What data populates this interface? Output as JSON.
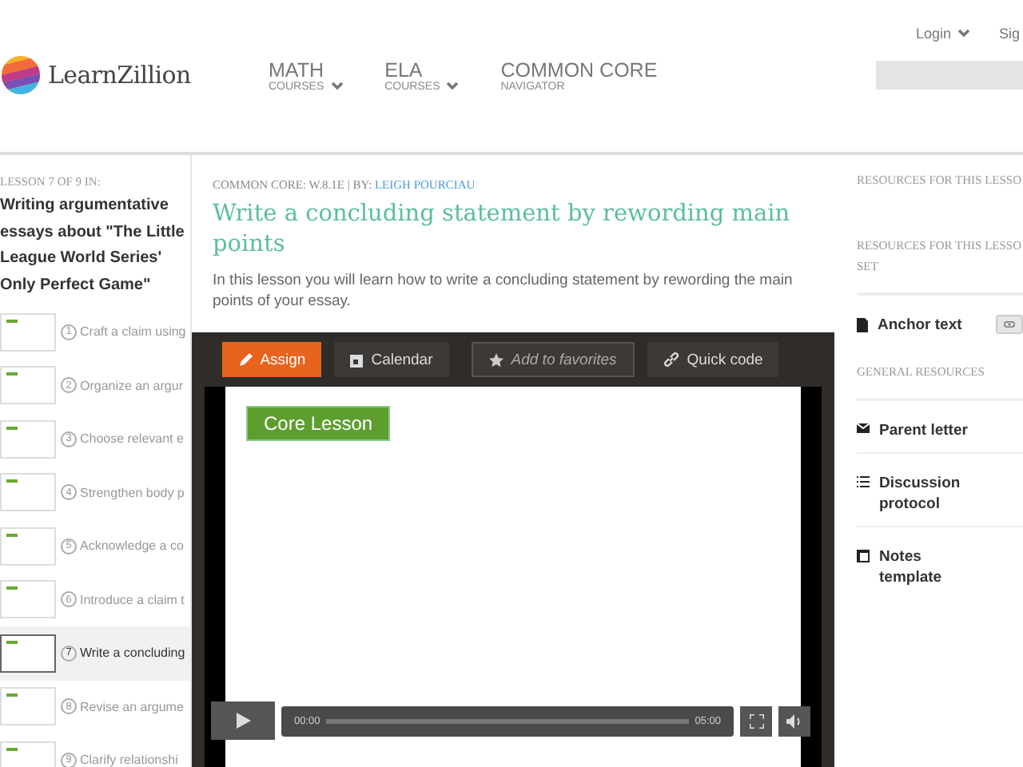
{
  "top_links": [
    {
      "label": "Login",
      "caret": true
    },
    {
      "label": "Sig",
      "caret": false
    }
  ],
  "brand": "LearnZillion",
  "nav": [
    {
      "title": "MATH",
      "subtitle": "COURSES",
      "dropdown": true
    },
    {
      "title": "ELA",
      "subtitle": "COURSES",
      "dropdown": true
    },
    {
      "title": "COMMON CORE",
      "subtitle": "NAVIGATOR",
      "dropdown": false
    }
  ],
  "sidebar": {
    "heading": "LESSON 7 OF 9 IN:",
    "set_title": "Writing argumentative essays about \"The Little League World Series' Only Perfect Game\"",
    "lessons": [
      {
        "number": "1",
        "title": "Craft a claim using",
        "selected": false
      },
      {
        "number": "2",
        "title": "Organize an argur",
        "selected": false
      },
      {
        "number": "3",
        "title": "Choose relevant e",
        "selected": false
      },
      {
        "number": "4",
        "title": "Strengthen body p",
        "selected": false
      },
      {
        "number": "5",
        "title": "Acknowledge a co",
        "selected": false
      },
      {
        "number": "6",
        "title": "Introduce a claim t",
        "selected": false
      },
      {
        "number": "7",
        "title": "Write a concluding",
        "selected": true
      },
      {
        "number": "8",
        "title": "Revise an argume",
        "selected": false
      },
      {
        "number": "9",
        "title": "Clarify relationshi",
        "selected": false
      }
    ]
  },
  "main": {
    "meta": "COMMON CORE: W.8.1E | BY:",
    "author": "LEIGH POURCIAU",
    "title": "Write a concluding statement by rewording main points",
    "summary": "In this lesson you will learn how to write a concluding statement by rewording the main points of your essay.",
    "actions": [
      {
        "label": "Assign",
        "kind": "assign"
      },
      {
        "label": "Add to favorites",
        "kind": "favorite"
      },
      {
        "label": "Quick code",
        "kind": "link"
      }
    ],
    "calendar": "Calendar",
    "video": {
      "slide_label": "Core Lesson",
      "elapsed": "00:00",
      "duration": "05:00",
      "level": 0
    }
  },
  "resources": {
    "sections": [
      {
        "heading_lines": [
          "RESOURCES FOR THIS LESSO"
        ]
      },
      {
        "heading_lines": [
          "RESOURCES FOR THIS LESSO",
          "SET"
        ],
        "items": [
          {
            "label": "Anchor text",
            "kind": "document",
            "preview": true
          }
        ]
      },
      {
        "heading_lines": [
          "GENERAL RESOURCES"
        ],
        "items": [
          {
            "label": "Parent letter",
            "kind": "envelope",
            "preview": false
          },
          {
            "label": "Discussion protocol",
            "kind": "list",
            "preview": false
          },
          {
            "label": "Notes template",
            "kind": "template",
            "preview": false
          }
        ]
      }
    ]
  }
}
